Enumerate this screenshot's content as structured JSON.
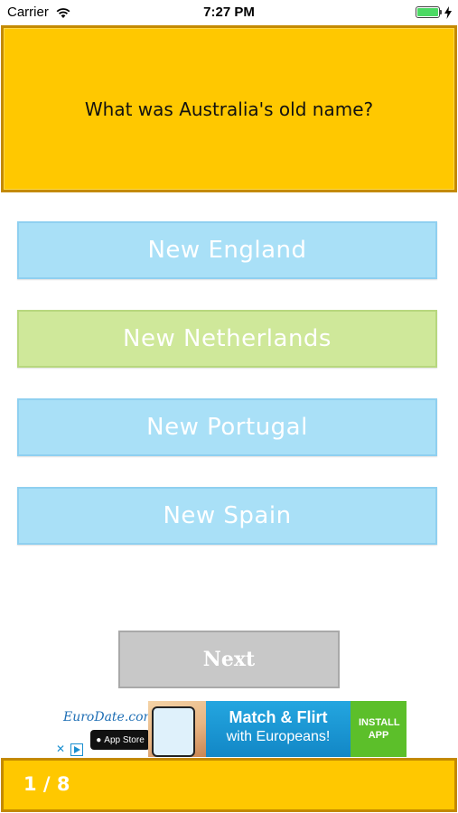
{
  "status_bar": {
    "carrier": "Carrier",
    "time": "7:27 PM",
    "icons": [
      "wifi-icon",
      "battery-icon",
      "charging-icon"
    ]
  },
  "question": {
    "text": "What was Australia's old name?"
  },
  "answers": [
    {
      "label": "New England",
      "selected": false
    },
    {
      "label": "New Netherlands",
      "selected": true
    },
    {
      "label": "New Portugal",
      "selected": false
    },
    {
      "label": "New Spain",
      "selected": false
    }
  ],
  "next_button": {
    "label": "Next"
  },
  "ad": {
    "brand": "EuroDate.com",
    "store_badge": "App Store",
    "headline": "Match & Flirt",
    "subline": "with Europeans!",
    "install": "INSTALL APP"
  },
  "footer": {
    "progress": "1 / 8"
  },
  "colors": {
    "accent_yellow": "#ffc800",
    "answer_blue": "#a9e0f7",
    "answer_selected_green": "#cfe89a",
    "next_gray": "#c8c8c8"
  }
}
